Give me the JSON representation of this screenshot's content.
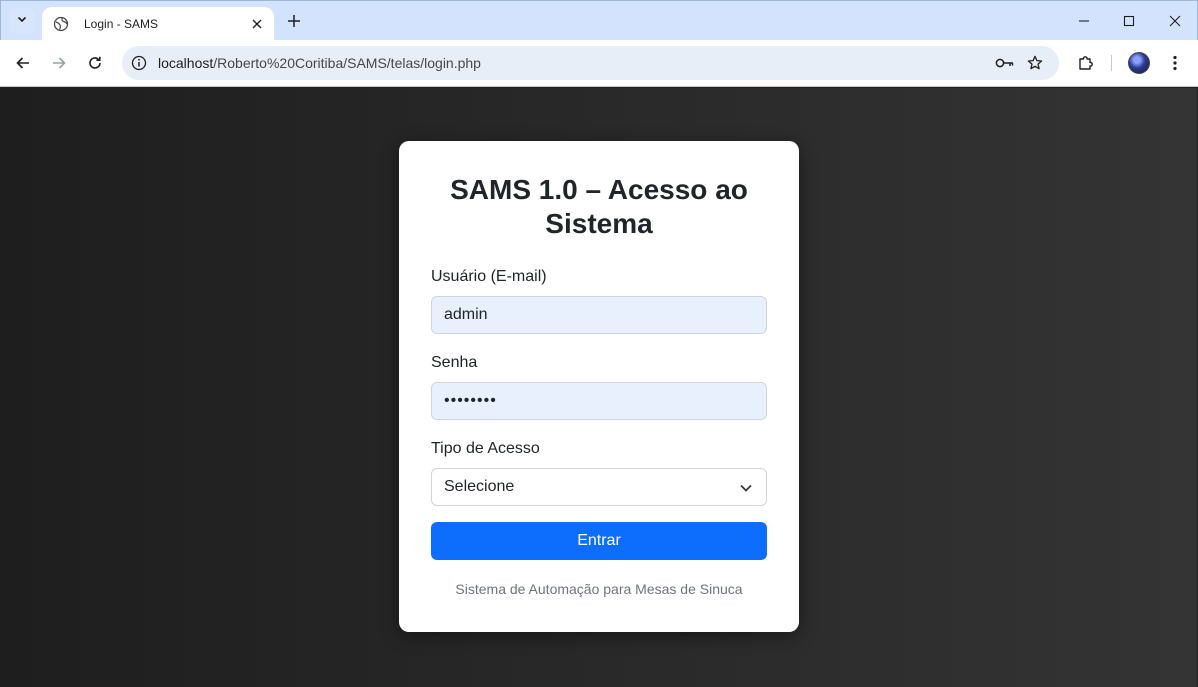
{
  "browser": {
    "tab_title": "Login - SAMS",
    "url_host": "localhost",
    "url_path": "/Roberto%20Coritiba/SAMS/telas/login.php",
    "icons": {
      "tab_search": "chevron-down-icon",
      "favicon": "globe-icon",
      "tab_close": "close-icon",
      "new_tab": "plus-icon",
      "minimize": "minimize-icon",
      "maximize": "maximize-icon",
      "close_window": "close-icon",
      "back": "back-arrow-icon",
      "forward": "forward-arrow-icon",
      "reload": "reload-icon",
      "site_info": "info-icon",
      "password": "key-icon",
      "bookmark": "star-icon",
      "extensions": "puzzle-icon",
      "menu": "kebab-menu-icon"
    }
  },
  "login": {
    "title": "SAMS 1.0 – Acesso ao Sistema",
    "user_label": "Usuário (E-mail)",
    "user_value": "admin",
    "password_label": "Senha",
    "password_value": "••••••••",
    "access_label": "Tipo de Acesso",
    "access_selected": "Selecione",
    "submit_label": "Entrar",
    "footer": "Sistema de Automação para Mesas de Sinuca"
  },
  "colors": {
    "primary": "#0d6efd",
    "autofill_bg": "#e8f0fe",
    "chrome_titlebar": "#d3e3fd"
  }
}
